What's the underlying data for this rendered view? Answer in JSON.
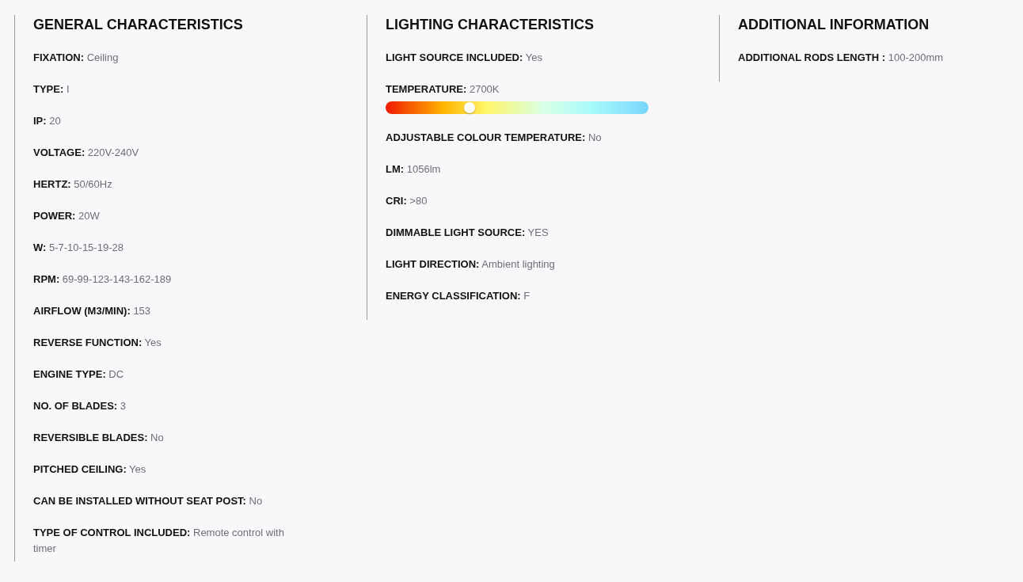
{
  "columns": [
    {
      "title": "GENERAL CHARACTERISTICS",
      "specs": [
        {
          "kind": "text",
          "text": "**FIXATION:** Ceiling"
        },
        {
          "kind": "text",
          "text": "**TYPE:** I"
        },
        {
          "kind": "text",
          "text": "**IP:** 20"
        },
        {
          "kind": "text",
          "text": "**VOLTAGE:** 220V-240V"
        },
        {
          "kind": "text",
          "text": "**HERTZ:** 50/60Hz"
        },
        {
          "kind": "text",
          "text": "**POWER:** 20W"
        },
        {
          "kind": "text",
          "text": "**W:** 5-7-10-15-19-28"
        },
        {
          "kind": "text",
          "text": "**RPM:** 69-99-123-143-162-189"
        },
        {
          "kind": "text",
          "text": "**AIRFLOW (M3/MIN):** 153"
        },
        {
          "kind": "text",
          "text": "**REVERSE FUNCTION:** Yes"
        },
        {
          "kind": "text",
          "text": "**ENGINE TYPE:** DC"
        },
        {
          "kind": "text",
          "text": "**NO. OF BLADES:** 3"
        },
        {
          "kind": "text",
          "text": "**REVERSIBLE BLADES:** No"
        },
        {
          "kind": "text",
          "text": "**PITCHED CEILING:** Yes"
        },
        {
          "kind": "text",
          "text": "**CAN BE INSTALLED WITHOUT SEAT POST:** No"
        },
        {
          "kind": "text",
          "text": "**TYPE OF CONTROL INCLUDED:** Remote control with timer"
        }
      ]
    },
    {
      "title": "LIGHTING CHARACTERISTICS",
      "specs": [
        {
          "kind": "text",
          "text": "**LIGHT SOURCE INCLUDED:** Yes"
        },
        {
          "kind": "slider",
          "text": "**TEMPERATURE:** 2700K",
          "level": 0.32
        },
        {
          "kind": "text",
          "text": "**ADJUSTABLE COLOUR TEMPERATURE:** No"
        },
        {
          "kind": "text",
          "text": "**LM:** 1056lm"
        },
        {
          "kind": "text",
          "text": "**CRI:** >80"
        },
        {
          "kind": "text",
          "text": "**DIMMABLE LIGHT SOURCE:** YES"
        },
        {
          "kind": "text",
          "text": "**LIGHT DIRECTION:** Ambient lighting"
        },
        {
          "kind": "text",
          "text": "**ENERGY CLASSIFICATION:** F"
        }
      ]
    },
    {
      "title": "ADDITIONAL INFORMATION",
      "specs": [
        {
          "kind": "text",
          "text": "**ADDITIONAL RODS LENGTH :** 100-200mm"
        }
      ]
    }
  ]
}
